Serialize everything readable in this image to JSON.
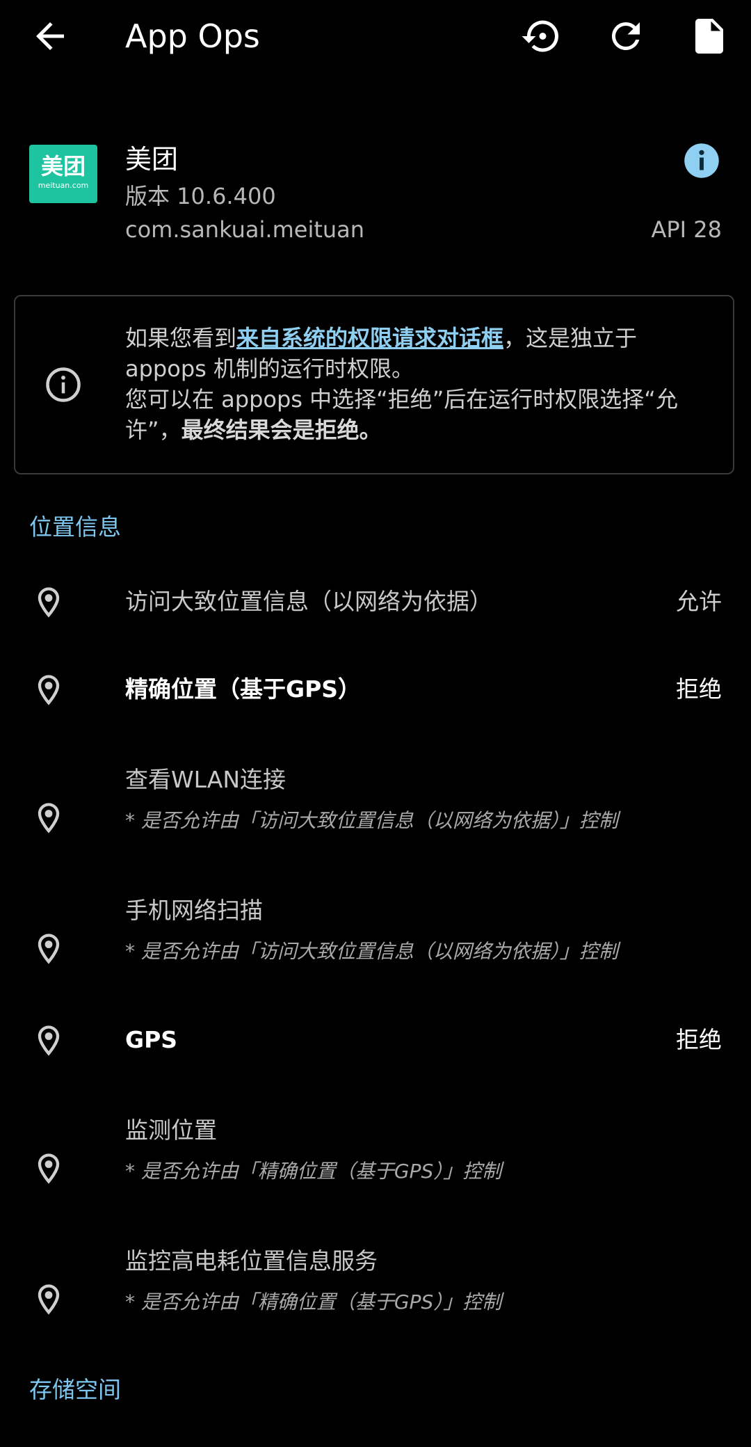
{
  "app_bar": {
    "title": "App Ops",
    "back_icon": "arrow-back-icon",
    "actions": [
      {
        "icon": "restore-history-icon"
      },
      {
        "icon": "refresh-icon"
      },
      {
        "icon": "file-icon"
      }
    ]
  },
  "app": {
    "icon_text_cn": "美团",
    "icon_text_en": "meituan.com",
    "icon_color": "#1ec4a0",
    "name": "美团",
    "version": "版本 10.6.400",
    "package": "com.sankuai.meituan",
    "api": "API 28",
    "info_icon": "info-circle-icon",
    "info_color": "#8fd0f2"
  },
  "notice": {
    "text_before_link": "如果您看到",
    "link": "来自系统的权限请求对话框",
    "text_after_link": "，这是独立于 appops 机制的运行时权限。",
    "line2": "您可以在 appops 中选择“拒绝”后在运行时权限选择“允许”，",
    "bold": "最终结果会是拒绝",
    "end": "。"
  },
  "sections": {
    "location": {
      "title": "位置信息",
      "items": [
        {
          "label": "访问大致位置信息（以网络为依据）",
          "status": "允许",
          "sub": ""
        },
        {
          "label": "精确位置（基于GPS）",
          "status": "拒绝",
          "sub": ""
        },
        {
          "label": "查看WLAN连接",
          "status": "",
          "sub": "* 是否允许由「访问大致位置信息（以网络为依据）」控制"
        },
        {
          "label": "手机网络扫描",
          "status": "",
          "sub": "* 是否允许由「访问大致位置信息（以网络为依据）」控制"
        },
        {
          "label": "GPS",
          "status": "拒绝",
          "sub": ""
        },
        {
          "label": "监测位置",
          "status": "",
          "sub": "* 是否允许由「精确位置（基于GPS）」控制"
        },
        {
          "label": "监控高电耗位置信息服务",
          "status": "",
          "sub": "* 是否允许由「精确位置（基于GPS）」控制"
        }
      ]
    },
    "storage": {
      "title": "存储空间"
    }
  },
  "colors": {
    "background": "#000000",
    "accent": "#7dc6ef",
    "link": "#8fd0f2"
  }
}
